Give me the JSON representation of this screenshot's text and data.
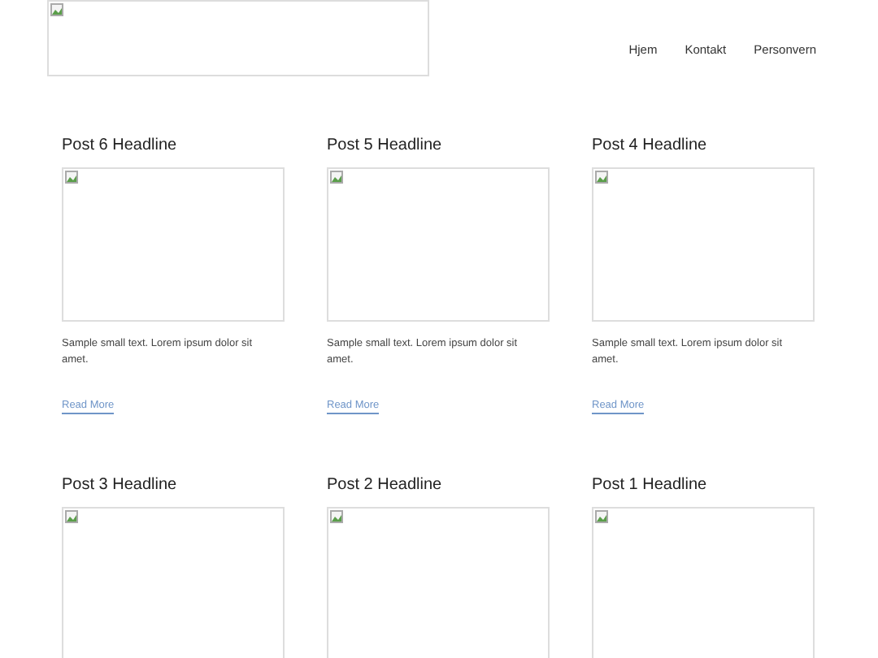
{
  "nav": {
    "items": [
      {
        "label": "Hjem"
      },
      {
        "label": "Kontakt"
      },
      {
        "label": "Personvern"
      }
    ]
  },
  "posts": [
    {
      "title": "Post 6 Headline",
      "excerpt": "Sample small text. Lorem ipsum dolor sit amet.",
      "link": "Read More"
    },
    {
      "title": "Post 5 Headline",
      "excerpt": "Sample small text. Lorem ipsum dolor sit amet.",
      "link": "Read More"
    },
    {
      "title": "Post 4 Headline",
      "excerpt": "Sample small text. Lorem ipsum dolor sit amet.",
      "link": "Read More"
    },
    {
      "title": "Post 3 Headline"
    },
    {
      "title": "Post 2 Headline"
    },
    {
      "title": "Post 1 Headline"
    }
  ]
}
